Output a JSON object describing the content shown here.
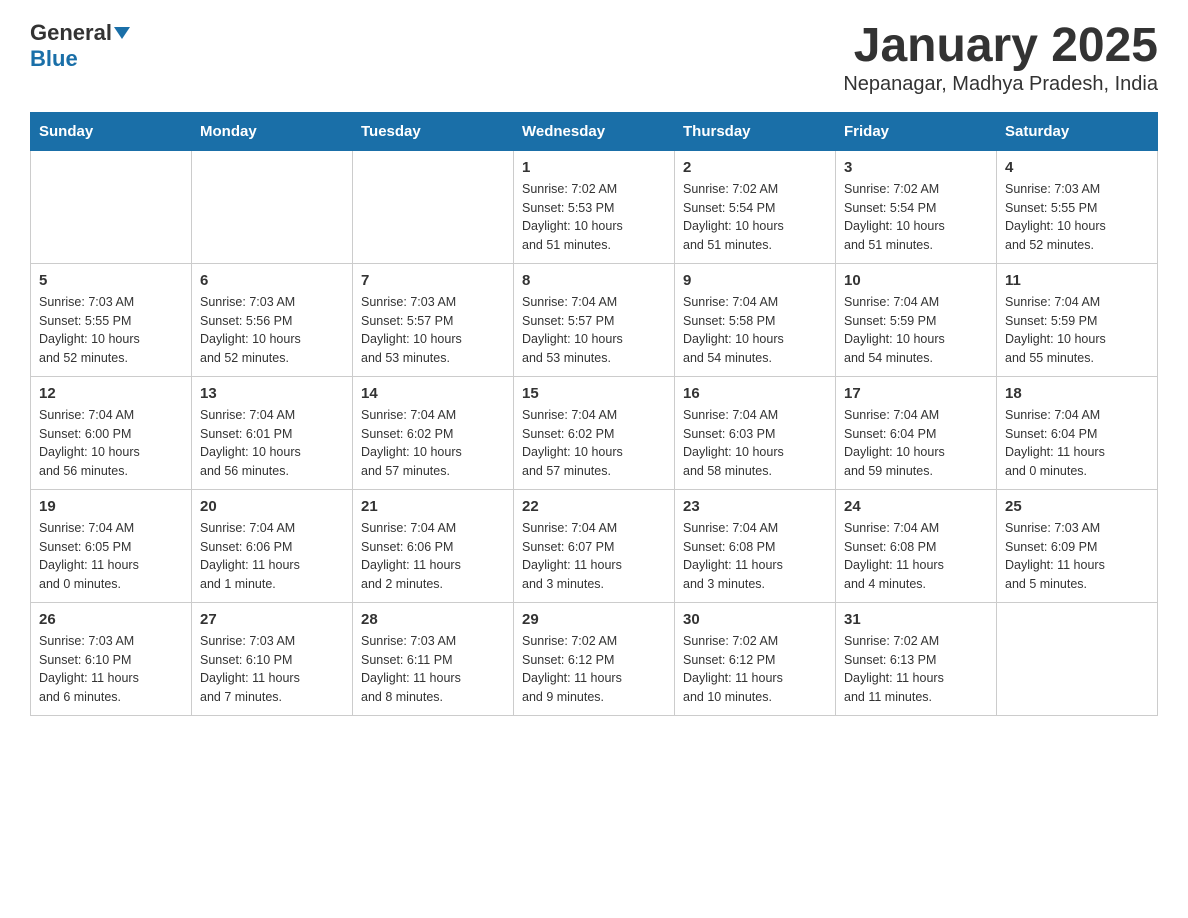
{
  "header": {
    "logo_general": "General",
    "logo_blue": "Blue",
    "title": "January 2025",
    "subtitle": "Nepanagar, Madhya Pradesh, India"
  },
  "days_of_week": [
    "Sunday",
    "Monday",
    "Tuesday",
    "Wednesday",
    "Thursday",
    "Friday",
    "Saturday"
  ],
  "weeks": [
    {
      "days": [
        {
          "num": "",
          "info": ""
        },
        {
          "num": "",
          "info": ""
        },
        {
          "num": "",
          "info": ""
        },
        {
          "num": "1",
          "info": "Sunrise: 7:02 AM\nSunset: 5:53 PM\nDaylight: 10 hours\nand 51 minutes."
        },
        {
          "num": "2",
          "info": "Sunrise: 7:02 AM\nSunset: 5:54 PM\nDaylight: 10 hours\nand 51 minutes."
        },
        {
          "num": "3",
          "info": "Sunrise: 7:02 AM\nSunset: 5:54 PM\nDaylight: 10 hours\nand 51 minutes."
        },
        {
          "num": "4",
          "info": "Sunrise: 7:03 AM\nSunset: 5:55 PM\nDaylight: 10 hours\nand 52 minutes."
        }
      ]
    },
    {
      "days": [
        {
          "num": "5",
          "info": "Sunrise: 7:03 AM\nSunset: 5:55 PM\nDaylight: 10 hours\nand 52 minutes."
        },
        {
          "num": "6",
          "info": "Sunrise: 7:03 AM\nSunset: 5:56 PM\nDaylight: 10 hours\nand 52 minutes."
        },
        {
          "num": "7",
          "info": "Sunrise: 7:03 AM\nSunset: 5:57 PM\nDaylight: 10 hours\nand 53 minutes."
        },
        {
          "num": "8",
          "info": "Sunrise: 7:04 AM\nSunset: 5:57 PM\nDaylight: 10 hours\nand 53 minutes."
        },
        {
          "num": "9",
          "info": "Sunrise: 7:04 AM\nSunset: 5:58 PM\nDaylight: 10 hours\nand 54 minutes."
        },
        {
          "num": "10",
          "info": "Sunrise: 7:04 AM\nSunset: 5:59 PM\nDaylight: 10 hours\nand 54 minutes."
        },
        {
          "num": "11",
          "info": "Sunrise: 7:04 AM\nSunset: 5:59 PM\nDaylight: 10 hours\nand 55 minutes."
        }
      ]
    },
    {
      "days": [
        {
          "num": "12",
          "info": "Sunrise: 7:04 AM\nSunset: 6:00 PM\nDaylight: 10 hours\nand 56 minutes."
        },
        {
          "num": "13",
          "info": "Sunrise: 7:04 AM\nSunset: 6:01 PM\nDaylight: 10 hours\nand 56 minutes."
        },
        {
          "num": "14",
          "info": "Sunrise: 7:04 AM\nSunset: 6:02 PM\nDaylight: 10 hours\nand 57 minutes."
        },
        {
          "num": "15",
          "info": "Sunrise: 7:04 AM\nSunset: 6:02 PM\nDaylight: 10 hours\nand 57 minutes."
        },
        {
          "num": "16",
          "info": "Sunrise: 7:04 AM\nSunset: 6:03 PM\nDaylight: 10 hours\nand 58 minutes."
        },
        {
          "num": "17",
          "info": "Sunrise: 7:04 AM\nSunset: 6:04 PM\nDaylight: 10 hours\nand 59 minutes."
        },
        {
          "num": "18",
          "info": "Sunrise: 7:04 AM\nSunset: 6:04 PM\nDaylight: 11 hours\nand 0 minutes."
        }
      ]
    },
    {
      "days": [
        {
          "num": "19",
          "info": "Sunrise: 7:04 AM\nSunset: 6:05 PM\nDaylight: 11 hours\nand 0 minutes."
        },
        {
          "num": "20",
          "info": "Sunrise: 7:04 AM\nSunset: 6:06 PM\nDaylight: 11 hours\nand 1 minute."
        },
        {
          "num": "21",
          "info": "Sunrise: 7:04 AM\nSunset: 6:06 PM\nDaylight: 11 hours\nand 2 minutes."
        },
        {
          "num": "22",
          "info": "Sunrise: 7:04 AM\nSunset: 6:07 PM\nDaylight: 11 hours\nand 3 minutes."
        },
        {
          "num": "23",
          "info": "Sunrise: 7:04 AM\nSunset: 6:08 PM\nDaylight: 11 hours\nand 3 minutes."
        },
        {
          "num": "24",
          "info": "Sunrise: 7:04 AM\nSunset: 6:08 PM\nDaylight: 11 hours\nand 4 minutes."
        },
        {
          "num": "25",
          "info": "Sunrise: 7:03 AM\nSunset: 6:09 PM\nDaylight: 11 hours\nand 5 minutes."
        }
      ]
    },
    {
      "days": [
        {
          "num": "26",
          "info": "Sunrise: 7:03 AM\nSunset: 6:10 PM\nDaylight: 11 hours\nand 6 minutes."
        },
        {
          "num": "27",
          "info": "Sunrise: 7:03 AM\nSunset: 6:10 PM\nDaylight: 11 hours\nand 7 minutes."
        },
        {
          "num": "28",
          "info": "Sunrise: 7:03 AM\nSunset: 6:11 PM\nDaylight: 11 hours\nand 8 minutes."
        },
        {
          "num": "29",
          "info": "Sunrise: 7:02 AM\nSunset: 6:12 PM\nDaylight: 11 hours\nand 9 minutes."
        },
        {
          "num": "30",
          "info": "Sunrise: 7:02 AM\nSunset: 6:12 PM\nDaylight: 11 hours\nand 10 minutes."
        },
        {
          "num": "31",
          "info": "Sunrise: 7:02 AM\nSunset: 6:13 PM\nDaylight: 11 hours\nand 11 minutes."
        },
        {
          "num": "",
          "info": ""
        }
      ]
    }
  ]
}
